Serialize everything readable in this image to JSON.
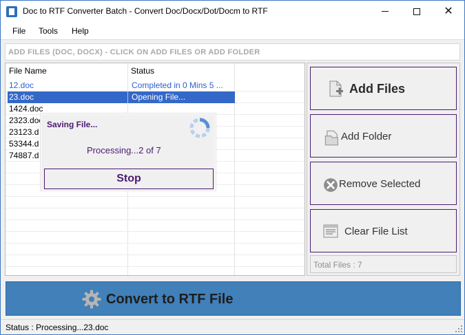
{
  "window": {
    "title": "Doc to RTF Converter Batch  -  Convert Doc/Docx/Dot/Docm to RTF",
    "minimize_glyph": "—",
    "maximize_glyph": "☐",
    "close_glyph": "✕"
  },
  "menu": [
    "File",
    "Tools",
    "Help"
  ],
  "hint": "ADD FILES (DOC, DOCX) - CLICK ON ADD FILES OR ADD FOLDER",
  "file_list": {
    "columns": [
      "File Name",
      "Status"
    ],
    "rows": [
      {
        "name": "12.doc",
        "status": "Completed in 0 Mins 5 ..."
      },
      {
        "name": "23.doc",
        "status": "Opening File..."
      },
      {
        "name": "1424.doc",
        "status": ""
      },
      {
        "name": "2323.doc",
        "status": ""
      },
      {
        "name": "23123.d",
        "status": ""
      },
      {
        "name": "53344.d",
        "status": ""
      },
      {
        "name": "74887.d",
        "status": ""
      }
    ]
  },
  "progress_dialog": {
    "title": "Saving File...",
    "progress": "Processing...2 of 7",
    "stop_label": "Stop"
  },
  "side": {
    "add_files": "Add Files",
    "add_folder": "Add Folder",
    "remove_selected": "Remove Selected",
    "clear_list": "Clear File List",
    "total_files": "Total Files : 7"
  },
  "convert_label": "Convert to RTF File",
  "status_text": "Status  :  Processing...23.doc",
  "colors": {
    "accent_purple": "#4b1a73",
    "selection_blue": "#3468c8",
    "convert_blue": "#4180b9",
    "completed_text": "#2d5fd1"
  },
  "icons": {
    "app": "app-icon",
    "add_files": "file-add-icon",
    "add_folder": "folder-icon",
    "remove": "remove-circle-icon",
    "clear": "clear-list-icon",
    "convert": "gear-icon",
    "spinner": "spinner-icon"
  }
}
